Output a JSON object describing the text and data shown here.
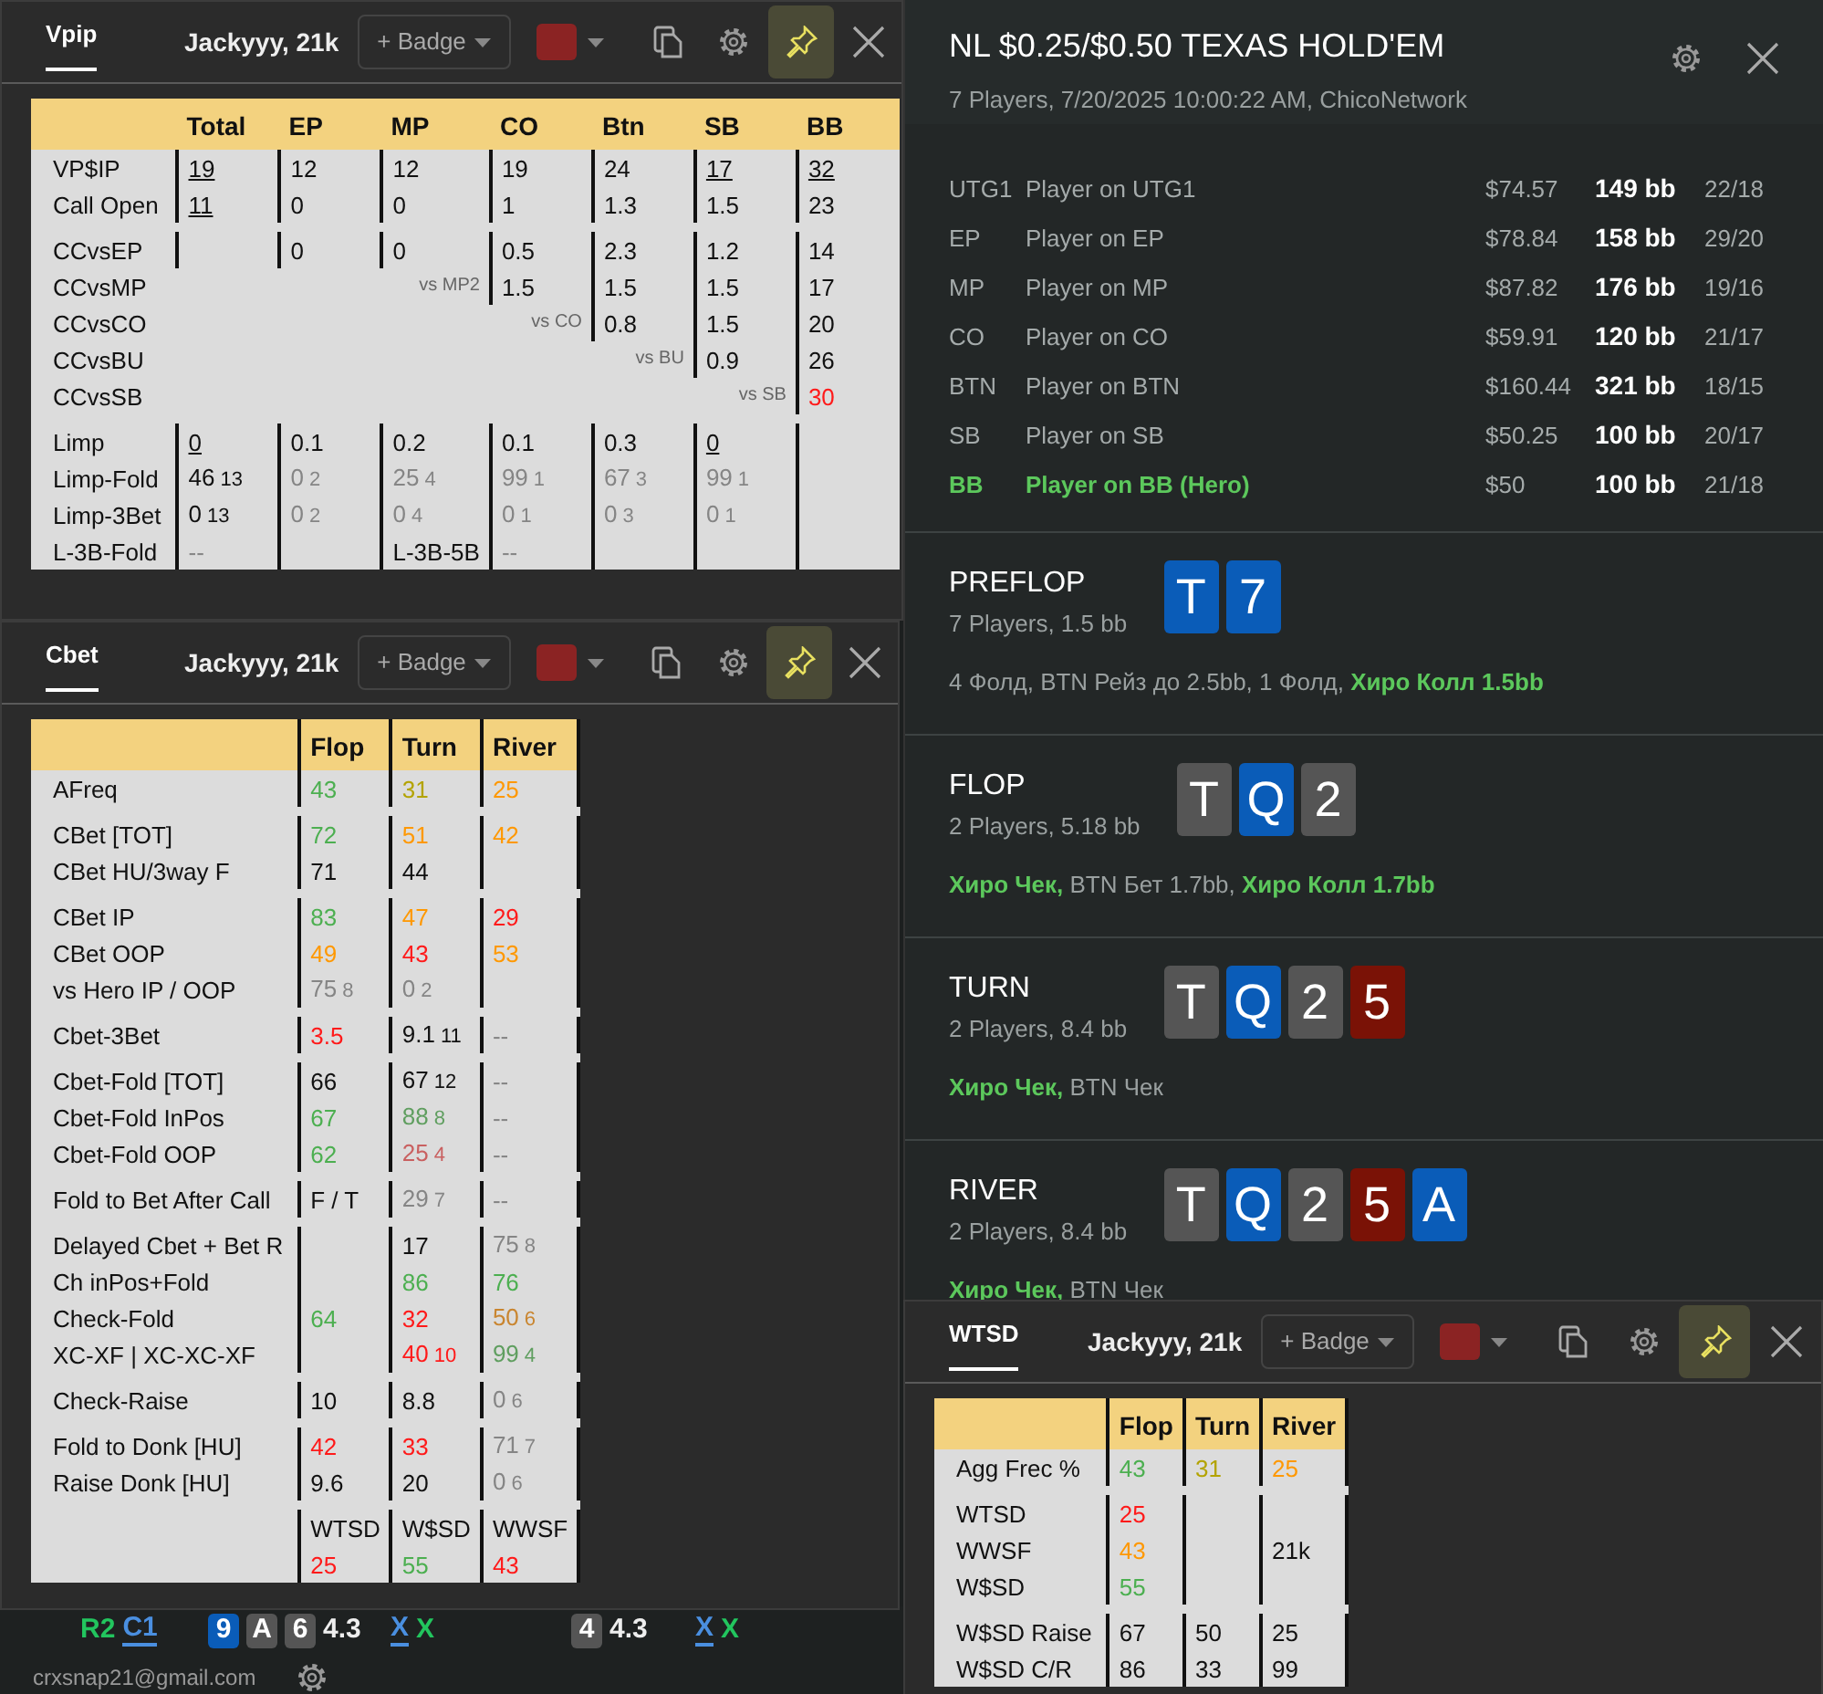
{
  "hud_windows": [
    {
      "tab": {
        "label": "Vpip",
        "selected": true
      },
      "player": "Jackyyy, 21k",
      "badge_button": "+ Badge",
      "swatch": {
        "color": "#8b2323"
      },
      "pinned": true,
      "table": {
        "columns": [
          "Total",
          "EP",
          "MP",
          "CO",
          "Btn",
          "SB",
          "BB"
        ],
        "header_rules": false,
        "trailing_rule": false,
        "groups": [
          {
            "rows": [
              {
                "label": "VP$IP",
                "cells": [
                  {
                    "text": "19",
                    "underline": true
                  },
                  "12",
                  "12",
                  "19",
                  "24",
                  {
                    "text": "17",
                    "underline": true
                  },
                  {
                    "text": "32",
                    "underline": true
                  }
                ]
              },
              {
                "label": "Call Open",
                "cells": [
                  {
                    "text": "11",
                    "underline": true
                  },
                  "0",
                  "0",
                  "1",
                  "1.3",
                  "1.5",
                  "23"
                ]
              }
            ]
          },
          {
            "rows": [
              {
                "label": "CCvsEP",
                "cells": [
                  null,
                  "0",
                  "0",
                  "0.5",
                  "2.3",
                  "1.2",
                  "14"
                ]
              },
              {
                "label": "CCvsMP",
                "cells": [
                  null,
                  null,
                  {
                    "kind": "note",
                    "text": "vs MP2"
                  },
                  "1.5",
                  "1.5",
                  "1.5",
                  "17"
                ]
              },
              {
                "label": "CCvsCO",
                "cells": [
                  null,
                  null,
                  null,
                  {
                    "kind": "note",
                    "text": "vs CO"
                  },
                  "0.8",
                  "1.5",
                  "20"
                ]
              },
              {
                "label": "CCvsBU",
                "cells": [
                  null,
                  null,
                  null,
                  null,
                  {
                    "kind": "note",
                    "text": "vs BU"
                  },
                  "0.9",
                  "26"
                ]
              },
              {
                "label": "CCvsSB",
                "cells": [
                  null,
                  null,
                  null,
                  null,
                  null,
                  {
                    "kind": "note",
                    "text": "vs SB"
                  },
                  {
                    "text": "30",
                    "color": "#ff1a1a"
                  }
                ]
              }
            ]
          },
          {
            "rows": [
              {
                "label": "Limp",
                "cells": [
                  {
                    "text": "0",
                    "underline": true
                  },
                  "0.1",
                  "0.2",
                  "0.1",
                  "0.3",
                  {
                    "text": "0",
                    "underline": true
                  },
                  null
                ]
              },
              {
                "label": "Limp-Fold",
                "cells": [
                  {
                    "text": "46",
                    "sub": "13"
                  },
                  {
                    "text": "0",
                    "sub": "2",
                    "color": "#858585"
                  },
                  {
                    "text": "25",
                    "sub": "4",
                    "color": "#858585"
                  },
                  {
                    "text": "99",
                    "sub": "1",
                    "color": "#858585"
                  },
                  {
                    "text": "67",
                    "sub": "3",
                    "color": "#858585"
                  },
                  {
                    "text": "99",
                    "sub": "1",
                    "color": "#858585"
                  },
                  null
                ]
              },
              {
                "label": "Limp-3Bet",
                "cells": [
                  {
                    "text": "0",
                    "sub": "13"
                  },
                  {
                    "text": "0",
                    "sub": "2",
                    "color": "#858585"
                  },
                  {
                    "text": "0",
                    "sub": "4",
                    "color": "#858585"
                  },
                  {
                    "text": "0",
                    "sub": "1",
                    "color": "#858585"
                  },
                  {
                    "text": "0",
                    "sub": "3",
                    "color": "#858585"
                  },
                  {
                    "text": "0",
                    "sub": "1",
                    "color": "#858585"
                  },
                  null
                ]
              },
              {
                "label": "L-3B-Fold",
                "cells": [
                  {
                    "text": "--",
                    "color": "#858585"
                  },
                  null,
                  "L-3B-5B",
                  {
                    "text": "--",
                    "color": "#858585"
                  },
                  null,
                  null,
                  null
                ]
              }
            ]
          }
        ]
      }
    },
    {
      "tab": {
        "label": "Cbet",
        "selected": true
      },
      "player": "Jackyyy, 21k",
      "badge_button": "+ Badge",
      "swatch": {
        "color": "#8b2323"
      },
      "pinned": true,
      "table": {
        "columns": [
          "Flop",
          "Turn",
          "River"
        ],
        "header_rules": true,
        "trailing_rule": true,
        "groups": [
          {
            "rows": [
              {
                "label": "AFreq",
                "cells": [
                  {
                    "text": "43",
                    "color": "#4caf50"
                  },
                  {
                    "text": "31",
                    "color": "#b3a300"
                  },
                  {
                    "text": "25",
                    "color": "#ff9800"
                  }
                ]
              }
            ]
          },
          {
            "rows": [
              {
                "label": "CBet [TOT]",
                "cells": [
                  {
                    "text": "72",
                    "color": "#4caf50"
                  },
                  {
                    "text": "51",
                    "color": "#ff9800"
                  },
                  {
                    "text": "42",
                    "color": "#ff9800"
                  }
                ]
              },
              {
                "label": "CBet HU/3way F",
                "cells": [
                  "71",
                  "44",
                  null
                ]
              }
            ]
          },
          {
            "rows": [
              {
                "label": "CBet IP",
                "cells": [
                  {
                    "text": "83",
                    "color": "#4caf50"
                  },
                  {
                    "text": "47",
                    "color": "#ff9800"
                  },
                  {
                    "text": "29",
                    "color": "#ff1a1a"
                  }
                ]
              },
              {
                "label": "CBet OOP",
                "cells": [
                  {
                    "text": "49",
                    "color": "#ff9800"
                  },
                  {
                    "text": "43",
                    "color": "#ff1a1a"
                  },
                  {
                    "text": "53",
                    "color": "#ff9800"
                  }
                ]
              },
              {
                "label": "vs Hero IP / OOP",
                "cells": [
                  {
                    "text": "75",
                    "sub": "8",
                    "color": "#858585"
                  },
                  {
                    "text": "0",
                    "sub": "2",
                    "color": "#858585"
                  },
                  null
                ]
              }
            ]
          },
          {
            "rows": [
              {
                "label": "Cbet-3Bet",
                "cells": [
                  {
                    "text": "3.5",
                    "color": "#ff1a1a"
                  },
                  {
                    "text": "9.1",
                    "sub": "11"
                  },
                  {
                    "text": "--",
                    "color": "#858585"
                  }
                ]
              }
            ]
          },
          {
            "rows": [
              {
                "label": "Cbet-Fold [TOT]",
                "cells": [
                  "66",
                  {
                    "text": "67",
                    "sub": "12"
                  },
                  {
                    "text": "--",
                    "color": "#858585"
                  }
                ]
              },
              {
                "label": "Cbet-Fold InPos",
                "cells": [
                  {
                    "text": "67",
                    "color": "#4caf50"
                  },
                  {
                    "text": "88",
                    "sub": "8",
                    "color": "#5f9e5f"
                  },
                  {
                    "text": "--",
                    "color": "#858585"
                  }
                ]
              },
              {
                "label": "Cbet-Fold OOP",
                "cells": [
                  {
                    "text": "62",
                    "color": "#4caf50"
                  },
                  {
                    "text": "25",
                    "sub": "4",
                    "color": "#c96060"
                  },
                  {
                    "text": "--",
                    "color": "#858585"
                  }
                ]
              }
            ]
          },
          {
            "rows": [
              {
                "label": "Fold to Bet After Call",
                "cells": [
                  "F / T",
                  {
                    "text": "29",
                    "sub": "7",
                    "color": "#858585"
                  },
                  {
                    "text": "--",
                    "color": "#858585"
                  }
                ]
              }
            ]
          },
          {
            "rows": [
              {
                "label": "Delayed Cbet + Bet R",
                "cells": [
                  null,
                  "17",
                  {
                    "text": "75",
                    "sub": "8",
                    "color": "#858585"
                  }
                ]
              },
              {
                "label": "Ch inPos+Fold",
                "cells": [
                  null,
                  {
                    "text": "86",
                    "color": "#4caf50"
                  },
                  {
                    "text": "76",
                    "color": "#4caf50"
                  }
                ]
              },
              {
                "label": "Check-Fold",
                "cells": [
                  {
                    "text": "64",
                    "color": "#4caf50"
                  },
                  {
                    "text": "32",
                    "color": "#ff1a1a"
                  },
                  {
                    "text": "50",
                    "sub": "6",
                    "color": "#c9852f"
                  }
                ]
              },
              {
                "label": "XC-XF | XC-XC-XF",
                "cells": [
                  null,
                  {
                    "text": "40",
                    "sub": "10",
                    "color": "#ff1a1a"
                  },
                  {
                    "text": "99",
                    "sub": "4",
                    "color": "#5f9e5f"
                  }
                ]
              }
            ]
          },
          {
            "rows": [
              {
                "label": "Check-Raise",
                "cells": [
                  "10",
                  "8.8",
                  {
                    "text": "0",
                    "sub": "6",
                    "color": "#858585"
                  }
                ]
              }
            ]
          },
          {
            "rows": [
              {
                "label": "Fold to Donk [HU]",
                "cells": [
                  {
                    "text": "42",
                    "color": "#ff1a1a"
                  },
                  {
                    "text": "33",
                    "color": "#ff1a1a"
                  },
                  {
                    "text": "71",
                    "sub": "7",
                    "color": "#858585"
                  }
                ]
              },
              {
                "label": "Raise Donk [HU]",
                "cells": [
                  "9.6",
                  "20",
                  {
                    "text": "0",
                    "sub": "6",
                    "color": "#858585"
                  }
                ]
              }
            ]
          },
          {
            "rows": [
              {
                "cells": [
                  "WTSD",
                  "W$SD",
                  "WWSF"
                ]
              },
              {
                "cells": [
                  {
                    "text": "25",
                    "color": "#ff1a1a"
                  },
                  {
                    "text": "55",
                    "color": "#4caf50"
                  },
                  {
                    "text": "43",
                    "color": "#ff1a1a"
                  }
                ]
              }
            ]
          }
        ]
      }
    },
    {
      "tab": {
        "label": "WTSD",
        "selected": true
      },
      "player": "Jackyyy, 21k",
      "badge_button": "+ Badge",
      "swatch": {
        "color": "#8b2323"
      },
      "pinned": true,
      "table": {
        "columns": [
          "Flop",
          "Turn",
          "River"
        ],
        "header_rules": true,
        "trailing_rule": true,
        "groups": [
          {
            "rows": [
              {
                "label": "Agg Frec %",
                "cells": [
                  {
                    "text": "43",
                    "color": "#4caf50"
                  },
                  {
                    "text": "31",
                    "color": "#b3a300"
                  },
                  {
                    "text": "25",
                    "color": "#ff9800"
                  }
                ]
              }
            ]
          },
          {
            "rows": [
              {
                "label": "WTSD",
                "cells": [
                  {
                    "text": "25",
                    "color": "#ff1a1a"
                  },
                  null,
                  null
                ]
              },
              {
                "label": "WWSF",
                "cells": [
                  {
                    "text": "43",
                    "color": "#ff9800"
                  },
                  null,
                  "21k"
                ]
              },
              {
                "label": "W$SD",
                "cells": [
                  {
                    "text": "55",
                    "color": "#4caf50"
                  },
                  null,
                  null
                ]
              }
            ]
          },
          {
            "rows": [
              {
                "label": "W$SD Raise",
                "cells": [
                  "67",
                  "50",
                  "25"
                ]
              },
              {
                "label": "W$SD C/R",
                "cells": [
                  "86",
                  "33",
                  "99"
                ]
              }
            ]
          }
        ]
      }
    }
  ],
  "hand_history": {
    "title": "NL $0.25/$0.50 TEXAS HOLD'EM",
    "subtitle": "7 Players, 7/20/2025 10:00:22 AM, ChicoNetwork",
    "players": [
      {
        "position": "UTG1",
        "name": "Player on UTG1",
        "stack": "$74.57",
        "bb": "149 bb",
        "stats": "22/18",
        "hero": false
      },
      {
        "position": "EP",
        "name": "Player on EP",
        "stack": "$78.84",
        "bb": "158 bb",
        "stats": "29/20",
        "hero": false
      },
      {
        "position": "MP",
        "name": "Player on MP",
        "stack": "$87.82",
        "bb": "176 bb",
        "stats": "19/16",
        "hero": false
      },
      {
        "position": "CO",
        "name": "Player on CO",
        "stack": "$59.91",
        "bb": "120 bb",
        "stats": "21/17",
        "hero": false
      },
      {
        "position": "BTN",
        "name": "Player on BTN",
        "stack": "$160.44",
        "bb": "321 bb",
        "stats": "18/15",
        "hero": false
      },
      {
        "position": "SB",
        "name": "Player on SB",
        "stack": "$50.25",
        "bb": "100 bb",
        "stats": "20/17",
        "hero": false
      },
      {
        "position": "BB",
        "name": "Player on BB (Hero)",
        "stack": "$50",
        "bb": "100 bb",
        "stats": "21/18",
        "hero": true
      }
    ],
    "streets": [
      {
        "name": "PREFLOP",
        "info": "7 Players, 1.5 bb",
        "cards": [
          {
            "rank": "T",
            "color": "#0a5cb8"
          },
          {
            "rank": "7",
            "color": "#0a5cb8"
          }
        ],
        "actions": "4 Фолд, BTN Рейз до 2.5bb, 1 Фолд, **Хиро Колл 1.5bb**"
      },
      {
        "name": "FLOP",
        "info": "2 Players, 5.18 bb",
        "cards": [
          {
            "rank": "T",
            "color": "#555555"
          },
          {
            "rank": "Q",
            "color": "#0a5cb8"
          },
          {
            "rank": "2",
            "color": "#555555"
          }
        ],
        "actions": "**Хиро Чек,** BTN Бет 1.7bb, **Хиро Колл 1.7bb**"
      },
      {
        "name": "TURN",
        "info": "2 Players, 8.4 bb",
        "cards": [
          {
            "rank": "T",
            "color": "#555555"
          },
          {
            "rank": "Q",
            "color": "#0a5cb8"
          },
          {
            "rank": "2",
            "color": "#555555"
          },
          {
            "rank": "5",
            "color": "#7a1206"
          }
        ],
        "actions": "**Хиро Чек,** BTN Чек"
      },
      {
        "name": "RIVER",
        "info": "2 Players, 8.4 bb",
        "cards": [
          {
            "rank": "T",
            "color": "#555555"
          },
          {
            "rank": "Q",
            "color": "#0a5cb8"
          },
          {
            "rank": "2",
            "color": "#555555"
          },
          {
            "rank": "5",
            "color": "#7a1206"
          },
          {
            "rank": "A",
            "color": "#0a5cb8"
          }
        ],
        "actions": "**Хиро Чек,** BTN Чек"
      }
    ]
  },
  "hud_strip": {
    "groups": [
      [
        {
          "kind": "text",
          "text": "R2",
          "color": "#22c55e"
        },
        {
          "kind": "text",
          "text": "C1",
          "color": "#4a8fe0",
          "underline": true
        }
      ],
      [
        {
          "kind": "card",
          "text": "9",
          "color": "#0a5cb8"
        },
        {
          "kind": "card",
          "text": "A",
          "color": "#555555"
        },
        {
          "kind": "card",
          "text": "6",
          "color": "#555555"
        },
        {
          "kind": "text",
          "text": "4.3"
        }
      ],
      [
        {
          "kind": "text",
          "text": "X",
          "color": "#4a8fe0",
          "underline": true
        },
        {
          "kind": "text",
          "text": "X",
          "color": "#22c55e"
        }
      ],
      [
        {
          "kind": "card",
          "text": "4",
          "color": "#555555"
        },
        {
          "kind": "text",
          "text": "4.3"
        }
      ],
      [
        {
          "kind": "text",
          "text": "X",
          "color": "#4a8fe0",
          "underline": true
        },
        {
          "kind": "text",
          "text": "X",
          "color": "#22c55e"
        }
      ]
    ],
    "account": "crxsnap21@gmail.com"
  }
}
